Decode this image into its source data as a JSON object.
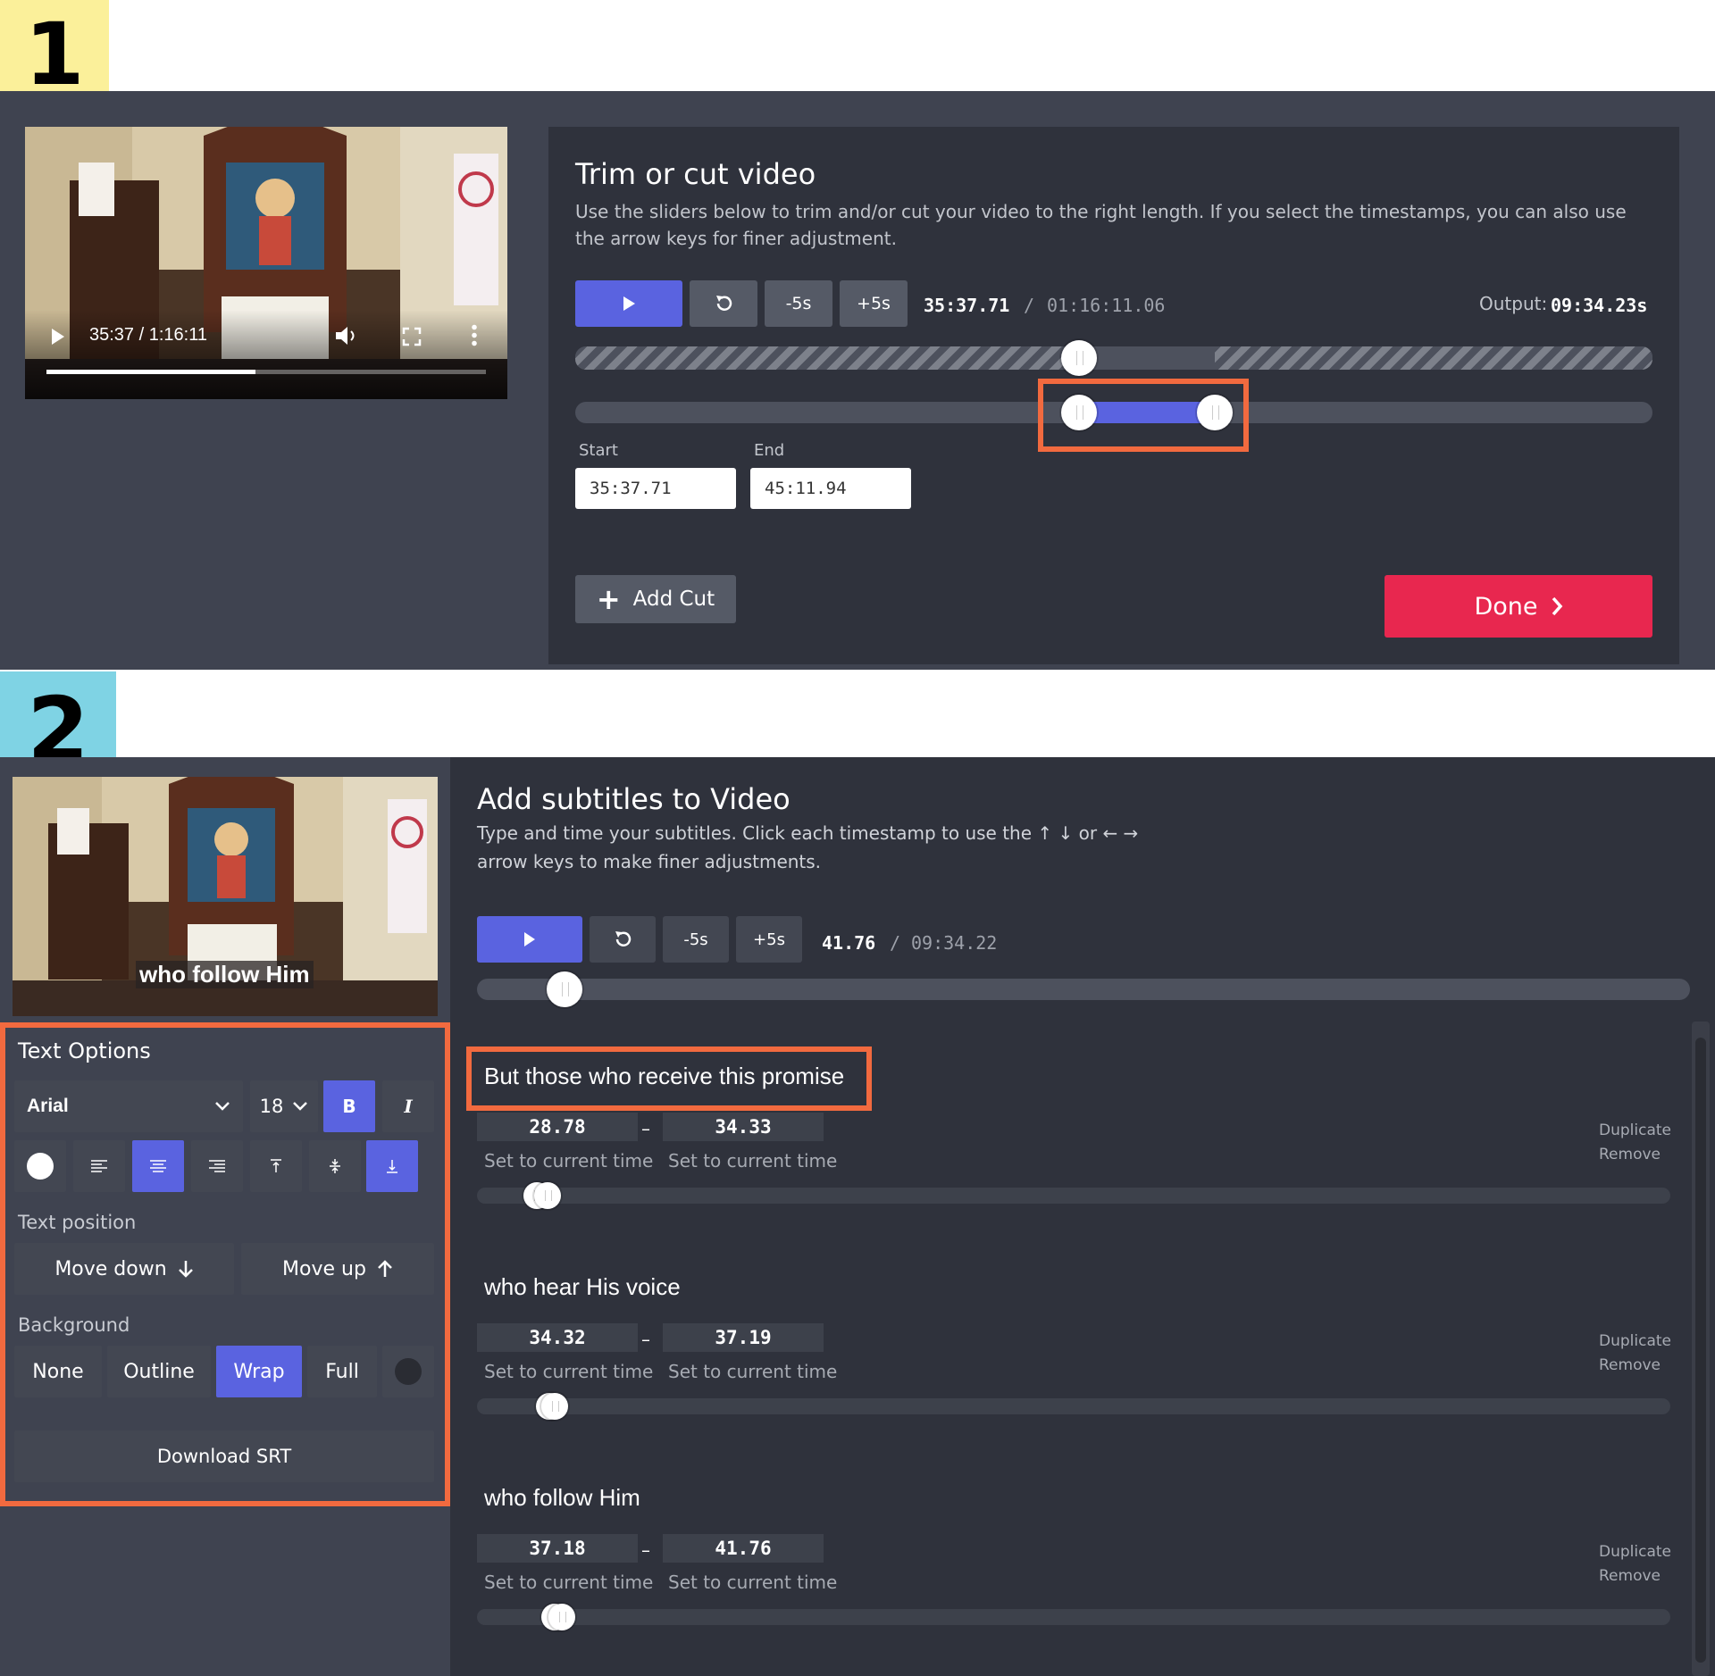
{
  "step1": {
    "number": "1",
    "video": {
      "time": "35:37 / 1:16:11"
    },
    "title": "Trim or cut video",
    "description": "Use the sliders below to trim and/or cut your video to the right length. If you select the timestamps, you can also use the arrow keys for finer adjustment.",
    "controls": {
      "minus": "-5s",
      "plus": "+5s"
    },
    "current_time": "35:37.71",
    "separator": "/",
    "total_time": "01:16:11.06",
    "output_label": "Output:",
    "output_value": "09:34.23s",
    "start_label": "Start",
    "end_label": "End",
    "start_value": "35:37.71",
    "end_value": "45:11.94",
    "add_cut": "Add Cut",
    "done": "Done"
  },
  "step2": {
    "number": "2",
    "video_caption": "who follow Him",
    "title": "Add subtitles to Video",
    "description_line1": "Type and time your subtitles. Click each timestamp to use the ↑ ↓ or ← →",
    "description_line2": "arrow keys to make finer adjustments.",
    "controls": {
      "minus": "-5s",
      "plus": "+5s"
    },
    "current_time": "41.76",
    "separator": "/",
    "total_time": "09:34.22",
    "text_options": {
      "heading": "Text Options",
      "font": "Arial",
      "size": "18",
      "bold": "B",
      "italic": "I",
      "text_position_label": "Text position",
      "move_down": "Move down",
      "move_up": "Move up",
      "background_label": "Background",
      "bg_none": "None",
      "bg_outline": "Outline",
      "bg_wrap": "Wrap",
      "bg_full": "Full",
      "download": "Download SRT"
    },
    "subtitles": [
      {
        "text": "But those who receive this promise",
        "start": "28.78",
        "end": "34.33",
        "set_start": "Set to current time",
        "set_end": "Set to current time",
        "duplicate": "Duplicate",
        "remove": "Remove"
      },
      {
        "text": "who hear His voice",
        "start": "34.32",
        "end": "37.19",
        "set_start": "Set to current time",
        "set_end": "Set to current time",
        "duplicate": "Duplicate",
        "remove": "Remove"
      },
      {
        "text": "who follow Him",
        "start": "37.18",
        "end": "41.76",
        "set_start": "Set to current time",
        "set_end": "Set to current time",
        "duplicate": "Duplicate",
        "remove": "Remove"
      }
    ],
    "dash": "–"
  },
  "colors": {
    "accent": "#5a63e0",
    "done": "#e8274f",
    "highlight": "#f26a3f",
    "step1_badge": "#fbf09a",
    "step2_badge": "#7fd3e4"
  }
}
